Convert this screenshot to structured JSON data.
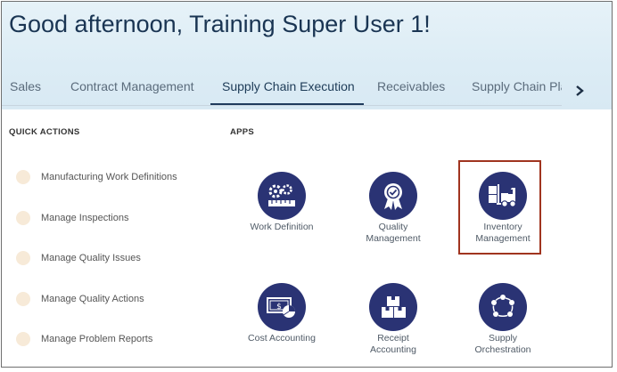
{
  "greeting": "Good afternoon, Training Super User 1!",
  "tabs": [
    {
      "label": "Sales",
      "active": false
    },
    {
      "label": "Contract Management",
      "active": false
    },
    {
      "label": "Supply Chain Execution",
      "active": true
    },
    {
      "label": "Receivables",
      "active": false
    },
    {
      "label": "Supply Chain Plan",
      "active": false
    }
  ],
  "quick_actions": {
    "title": "QUICK ACTIONS",
    "items": [
      {
        "label": "Manufacturing Work Definitions",
        "icon": "work-definitions-icon"
      },
      {
        "label": "Manage Inspections",
        "icon": "inspections-icon"
      },
      {
        "label": "Manage Quality Issues",
        "icon": "quality-issues-icon"
      },
      {
        "label": "Manage Quality Actions",
        "icon": "quality-actions-icon"
      },
      {
        "label": "Manage Problem Reports",
        "icon": "problem-reports-icon"
      }
    ]
  },
  "apps": {
    "title": "APPS",
    "items": [
      {
        "label": "Work Definition",
        "icon": "gears-ruler-icon"
      },
      {
        "label": "Quality\nManagement",
        "icon": "award-ribbon-icon"
      },
      {
        "label": "Inventory\nManagement",
        "icon": "forklift-icon",
        "highlighted": true
      },
      {
        "label": "Cost Accounting",
        "icon": "cash-chart-icon"
      },
      {
        "label": "Receipt\nAccounting",
        "icon": "boxes-icon"
      },
      {
        "label": "Supply\nOrchestration",
        "icon": "cycle-arrows-icon"
      }
    ]
  },
  "colors": {
    "app_circle": "#2a3374",
    "highlight_border": "#a0341f",
    "hero_bg": "#dcecf5"
  }
}
